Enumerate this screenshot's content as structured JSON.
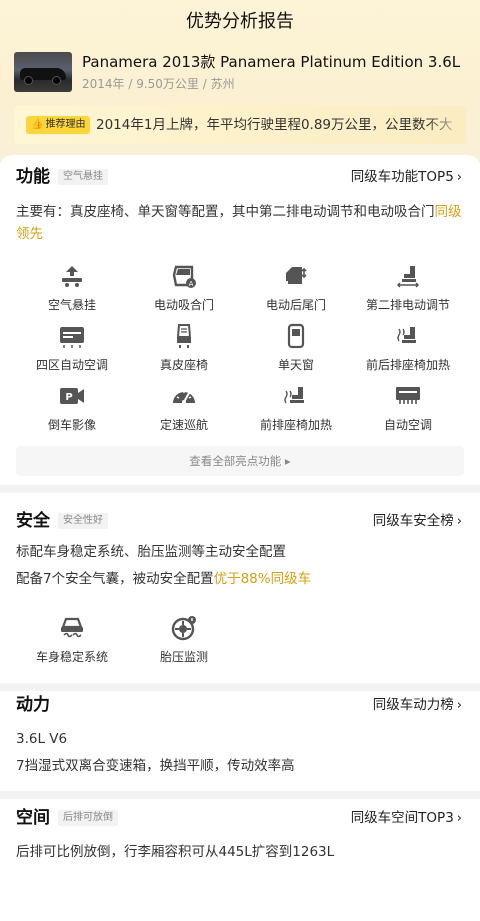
{
  "header": {
    "title": "优势分析报告"
  },
  "car": {
    "name": "Panamera 2013款 Panamera Platinum Edition 3.6L",
    "meta": "2014年 / 9.50万公里 / 苏州"
  },
  "reason": {
    "badge": "推荐理由",
    "text": "2014年1月上牌，年平均行驶里程0.89万公里，公里数不大"
  },
  "function": {
    "title": "功能",
    "tag": "空气悬挂",
    "link": "同级车功能TOP5",
    "desc_main": "主要有：真皮座椅、单天窗等配置，其中第二排电动调节和电动吸合门",
    "desc_hl": "同级领先",
    "features": [
      {
        "label": "空气悬挂",
        "icon": "air-suspension-icon"
      },
      {
        "label": "电动吸合门",
        "icon": "soft-close-door-icon"
      },
      {
        "label": "电动后尾门",
        "icon": "power-tailgate-icon"
      },
      {
        "label": "第二排电动调节",
        "icon": "second-row-seat-icon"
      },
      {
        "label": "四区自动空调",
        "icon": "four-zone-ac-icon"
      },
      {
        "label": "真皮座椅",
        "icon": "leather-seat-icon"
      },
      {
        "label": "单天窗",
        "icon": "sunroof-icon"
      },
      {
        "label": "前后排座椅加热",
        "icon": "seat-heating-icon"
      },
      {
        "label": "倒车影像",
        "icon": "rear-camera-icon"
      },
      {
        "label": "定速巡航",
        "icon": "cruise-control-icon"
      },
      {
        "label": "前排座椅加热",
        "icon": "front-seat-heating-icon"
      },
      {
        "label": "自动空调",
        "icon": "auto-ac-icon"
      }
    ],
    "view_all": "查看全部亮点功能"
  },
  "safety": {
    "title": "安全",
    "tag": "安全性好",
    "link": "同级车安全榜",
    "line1": "标配车身稳定系统、胎压监测等主动安全配置",
    "line2_main": "配备7个安全气囊，被动安全配置",
    "line2_hl": "优于88%同级车",
    "features": [
      {
        "label": "车身稳定系统",
        "icon": "stability-control-icon"
      },
      {
        "label": "胎压监测",
        "icon": "tire-pressure-icon"
      }
    ]
  },
  "power": {
    "title": "动力",
    "link": "同级车动力榜",
    "line1": "3.6L V6",
    "line2": "7挡湿式双离合变速箱，换挡平顺，传动效率高"
  },
  "space": {
    "title": "空间",
    "tag": "后排可放倒",
    "link": "同级车空间TOP3",
    "line1": "后排可比例放倒，行李厢容积可从445L扩容到1263L"
  },
  "colors": {
    "accent": "#d4a017",
    "badge": "#fbd53a",
    "header_bg": "#fdf3d6"
  }
}
